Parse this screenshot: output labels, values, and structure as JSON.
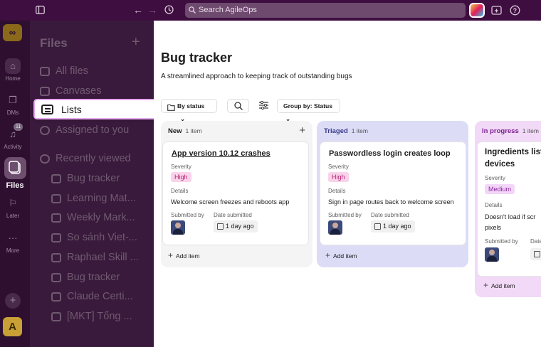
{
  "topbar": {
    "search_placeholder": "Search AgileOps"
  },
  "rail": {
    "home": "Home",
    "dms": "DMs",
    "activity": "Activity",
    "activity_badge": "11",
    "files": "Files",
    "later": "Later",
    "more": "More",
    "workspace_avatar": "A"
  },
  "sidebar": {
    "title": "Files",
    "items": [
      {
        "label": "All files"
      },
      {
        "label": "Canvases"
      },
      {
        "label": "Lists"
      },
      {
        "label": "Assigned to you"
      }
    ],
    "recent_header": "Recently viewed",
    "recent": [
      {
        "label": "Bug tracker"
      },
      {
        "label": "Learning Mat..."
      },
      {
        "label": "Weekly Mark..."
      },
      {
        "label": "So sánh Viet-..."
      },
      {
        "label": "Raphael Skill ..."
      },
      {
        "label": "Bug tracker"
      },
      {
        "label": "Claude Certi..."
      },
      {
        "label": "[MKT] Tổng ..."
      }
    ]
  },
  "main": {
    "title": "Bug tracker",
    "description": "A streamlined approach to keeping track of outstanding bugs",
    "toolbar": {
      "by_status": "By status",
      "group_by": "Group by: Status"
    },
    "columns": [
      {
        "name": "New",
        "count": "1 item",
        "card": {
          "title": "App version 10.12 crashes",
          "severity_label": "Severity",
          "severity": "High",
          "details_label": "Details",
          "details": "Welcome screen freezes and reboots app",
          "submitted_by_label": "Submitted by",
          "date_label": "Date submitted",
          "date": "1 day ago"
        },
        "add_item": "Add item"
      },
      {
        "name": "Triaged",
        "count": "1 item",
        "card": {
          "title": "Passwordless login creates loop",
          "severity_label": "Severity",
          "severity": "High",
          "details_label": "Details",
          "details": "Sign in page routes back to welcome screen",
          "submitted_by_label": "Submitted by",
          "date_label": "Date submitted",
          "date": "1 day ago"
        },
        "add_item": "Add item"
      },
      {
        "name": "In progress",
        "count": "1 item",
        "card": {
          "title_line1": "Ingredients list",
          "title_line2": "devices",
          "severity_label": "Severity",
          "severity": "Medium",
          "details_label": "Details",
          "details_line1": "Doesn't load if scr",
          "details_line2": "pixels",
          "submitted_by_label": "Submitted by",
          "date_label": "Date"
        },
        "add_item": "Add item"
      }
    ]
  },
  "colors": {
    "topbar": "#3f0e40",
    "sidebar": "#3a1a3c",
    "col_new": "#f4f4f4",
    "col_triaged": "#dcdcf7",
    "col_in_progress": "#f2d9f7",
    "severity_high": "#f9d3ea"
  }
}
